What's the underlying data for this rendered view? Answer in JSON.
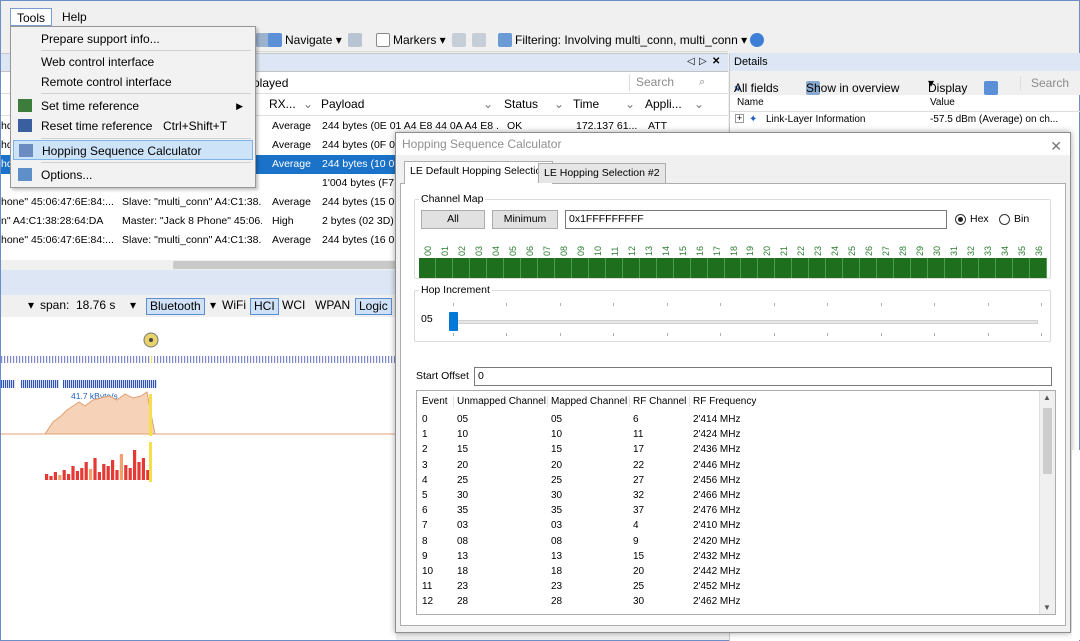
{
  "menubar": {
    "tools": "Tools",
    "help": "Help"
  },
  "toolbar": {
    "navigate": "Navigate",
    "markers": "Markers",
    "filtering": "Filtering: Involving multi_conn, multi_conn"
  },
  "grid": {
    "played_suffix": "played",
    "search_placeholder": "Search",
    "columns": [
      "RX...",
      "Payload",
      "Status",
      "Time",
      "Appli..."
    ],
    "rows": [
      {
        "c0": "hd",
        "c1": "",
        "rx": "Average",
        "payload": "244 bytes (0E 01 A4 E8 44 0A A4 E8 ...",
        "status": "OK",
        "time": "172.137 61...",
        "app": "ATT",
        "sel": false
      },
      {
        "c0": "hd",
        "c1": "",
        "rx": "Average",
        "payload": "244 bytes (0F 01",
        "status": "",
        "time": "",
        "app": "",
        "sel": false
      },
      {
        "c0": "hd",
        "c1": "",
        "rx": "Average",
        "payload": "244 bytes (10 0",
        "status": "",
        "time": "",
        "app": "",
        "sel": true
      },
      {
        "c0": "",
        "c1": "",
        "rx": "",
        "payload": "1'004 bytes (F7 0",
        "status": "",
        "time": "",
        "app": "",
        "sel": false
      },
      {
        "c0": "hone\" 45:06:47:6E:84:...",
        "c1": "Slave: \"multi_conn\" A4:C1:38...",
        "rx": "Average",
        "payload": "244 bytes (15 0",
        "status": "",
        "time": "",
        "app": "",
        "sel": false
      },
      {
        "c0": "n\" A4:C1:38:28:64:DA",
        "c1": "Master: \"Jack 8 Phone\" 45:06...",
        "rx": "High",
        "payload": "2 bytes (02 3D)",
        "status": "",
        "time": "",
        "app": "",
        "sel": false
      },
      {
        "c0": "hone\" 45:06:47:6E:84:...",
        "c1": "Slave: \"multi_conn\" A4:C1:38...",
        "rx": "Average",
        "payload": "244 bytes (16 0",
        "status": "",
        "time": "",
        "app": "",
        "sel": false
      }
    ]
  },
  "timeline": {
    "span_label": "span:",
    "span_value": "18.76 s",
    "filters": [
      "Bluetooth",
      "WiFi",
      "HCI",
      "WCI",
      "WPAN",
      "Logic"
    ],
    "rate": "41.7 kByte/s"
  },
  "details": {
    "title": "Details",
    "all_fields": "All fields",
    "show_overview": "Show in overview",
    "display": "Display",
    "search": "Search",
    "col_name": "Name",
    "col_value": "Value",
    "row_name": "Link-Layer Information",
    "row_value": "-57.5 dBm (Average) on ch..."
  },
  "tools_menu": {
    "items": [
      {
        "label": "Prepare support info...",
        "shortcut": "",
        "submenu": false,
        "highlight": false
      },
      {
        "label": "Web control interface",
        "shortcut": "",
        "submenu": false,
        "highlight": false
      },
      {
        "label": "Remote control interface",
        "shortcut": "",
        "submenu": false,
        "highlight": false
      },
      {
        "label": "Set time reference",
        "shortcut": "",
        "submenu": true,
        "highlight": false
      },
      {
        "label": "Reset time reference",
        "shortcut": "Ctrl+Shift+T",
        "submenu": false,
        "highlight": false
      },
      {
        "label": "Hopping Sequence Calculator",
        "shortcut": "",
        "submenu": false,
        "highlight": true
      },
      {
        "label": "Options...",
        "shortcut": "",
        "submenu": false,
        "highlight": false
      }
    ]
  },
  "dialog": {
    "title": "Hopping Sequence Calculator",
    "tabs": [
      "LE Default Hopping Selection",
      "LE Hopping Selection #2"
    ],
    "channel_map": {
      "label": "Channel Map",
      "all_button": "All",
      "minimum_button": "Minimum",
      "value": "0x1FFFFFFFFF",
      "hex_label": "Hex",
      "bin_label": "Bin",
      "channels": [
        "00",
        "01",
        "02",
        "03",
        "04",
        "05",
        "06",
        "07",
        "08",
        "09",
        "10",
        "11",
        "12",
        "13",
        "14",
        "15",
        "16",
        "17",
        "18",
        "19",
        "20",
        "21",
        "22",
        "23",
        "24",
        "25",
        "26",
        "27",
        "28",
        "29",
        "30",
        "31",
        "32",
        "33",
        "34",
        "35",
        "36"
      ]
    },
    "hop_increment": {
      "label": "Hop Increment",
      "value": "05",
      "min": 5,
      "max": 16
    },
    "start_offset": {
      "label": "Start Offset",
      "value": "0"
    },
    "table": {
      "columns": [
        "Event",
        "Unmapped Channel",
        "Mapped Channel",
        "RF Channel",
        "RF Frequency"
      ],
      "rows": [
        [
          "0",
          "05",
          "05",
          "6",
          "2'414 MHz"
        ],
        [
          "1",
          "10",
          "10",
          "11",
          "2'424 MHz"
        ],
        [
          "2",
          "15",
          "15",
          "17",
          "2'436 MHz"
        ],
        [
          "3",
          "20",
          "20",
          "22",
          "2'446 MHz"
        ],
        [
          "4",
          "25",
          "25",
          "27",
          "2'456 MHz"
        ],
        [
          "5",
          "30",
          "30",
          "32",
          "2'466 MHz"
        ],
        [
          "6",
          "35",
          "35",
          "37",
          "2'476 MHz"
        ],
        [
          "7",
          "03",
          "03",
          "4",
          "2'410 MHz"
        ],
        [
          "8",
          "08",
          "08",
          "9",
          "2'420 MHz"
        ],
        [
          "9",
          "13",
          "13",
          "15",
          "2'432 MHz"
        ],
        [
          "10",
          "18",
          "18",
          "20",
          "2'442 MHz"
        ],
        [
          "11",
          "23",
          "23",
          "25",
          "2'452 MHz"
        ],
        [
          "12",
          "28",
          "28",
          "30",
          "2'462 MHz"
        ]
      ]
    }
  },
  "colors": {
    "accent": "#1a73c9",
    "channel_green": "#1e6e1e",
    "rate_fill": "#f6d2b8",
    "bar_red": "#e53935"
  }
}
